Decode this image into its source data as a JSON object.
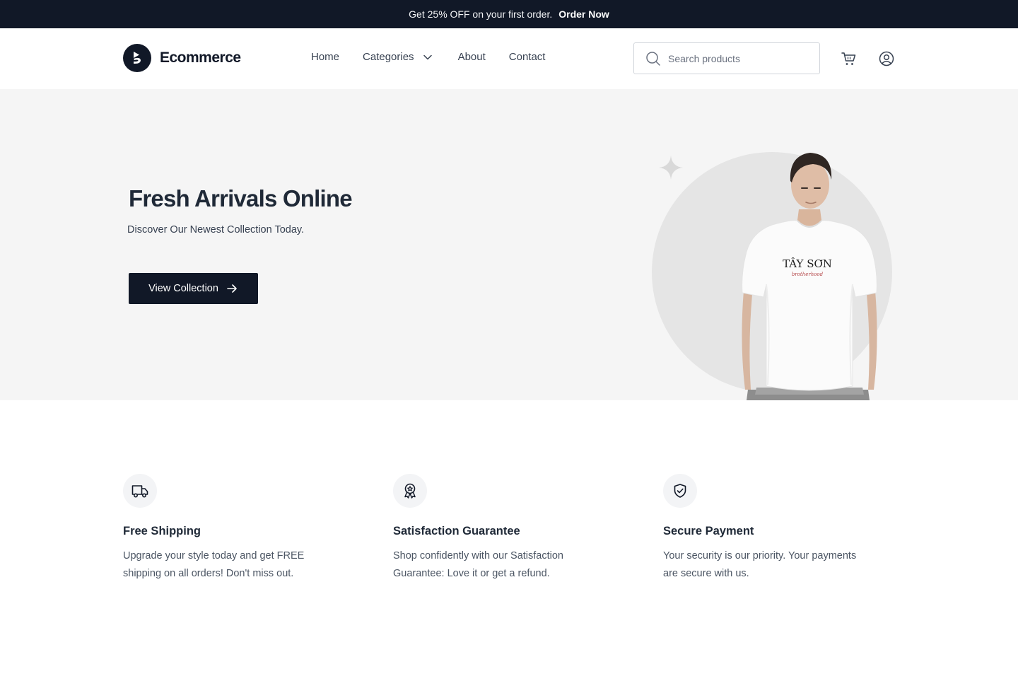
{
  "announcement": {
    "text": "Get 25% OFF on your first order.",
    "link": "Order Now"
  },
  "brand": {
    "name": "Ecommerce",
    "logo_icon": "brand-logo-icon"
  },
  "nav": {
    "home": "Home",
    "categories": "Categories",
    "about": "About",
    "contact": "Contact"
  },
  "search": {
    "placeholder": "Search products",
    "value": ""
  },
  "header_icons": {
    "cart": "cart-icon",
    "user": "user-circle-icon"
  },
  "hero": {
    "title": "Fresh Arrivals Online",
    "subtitle": "Discover Our Newest Collection Today.",
    "button": "View Collection",
    "shirt_print": "TÂY SƠN",
    "shirt_script": "brotherhood"
  },
  "features": [
    {
      "icon": "truck-icon",
      "title": "Free Shipping",
      "desc": "Upgrade your style today and get FREE shipping on all orders! Don't miss out."
    },
    {
      "icon": "badge-icon",
      "title": "Satisfaction Guarantee",
      "desc": "Shop confidently with our Satisfaction Guarantee: Love it or get a refund."
    },
    {
      "icon": "shield-check-icon",
      "title": "Secure Payment",
      "desc": "Your security is our priority. Your payments are secure with us."
    }
  ],
  "colors": {
    "dark": "#111827",
    "hero_bg": "#f5f5f5",
    "text_muted": "#4b5563"
  }
}
